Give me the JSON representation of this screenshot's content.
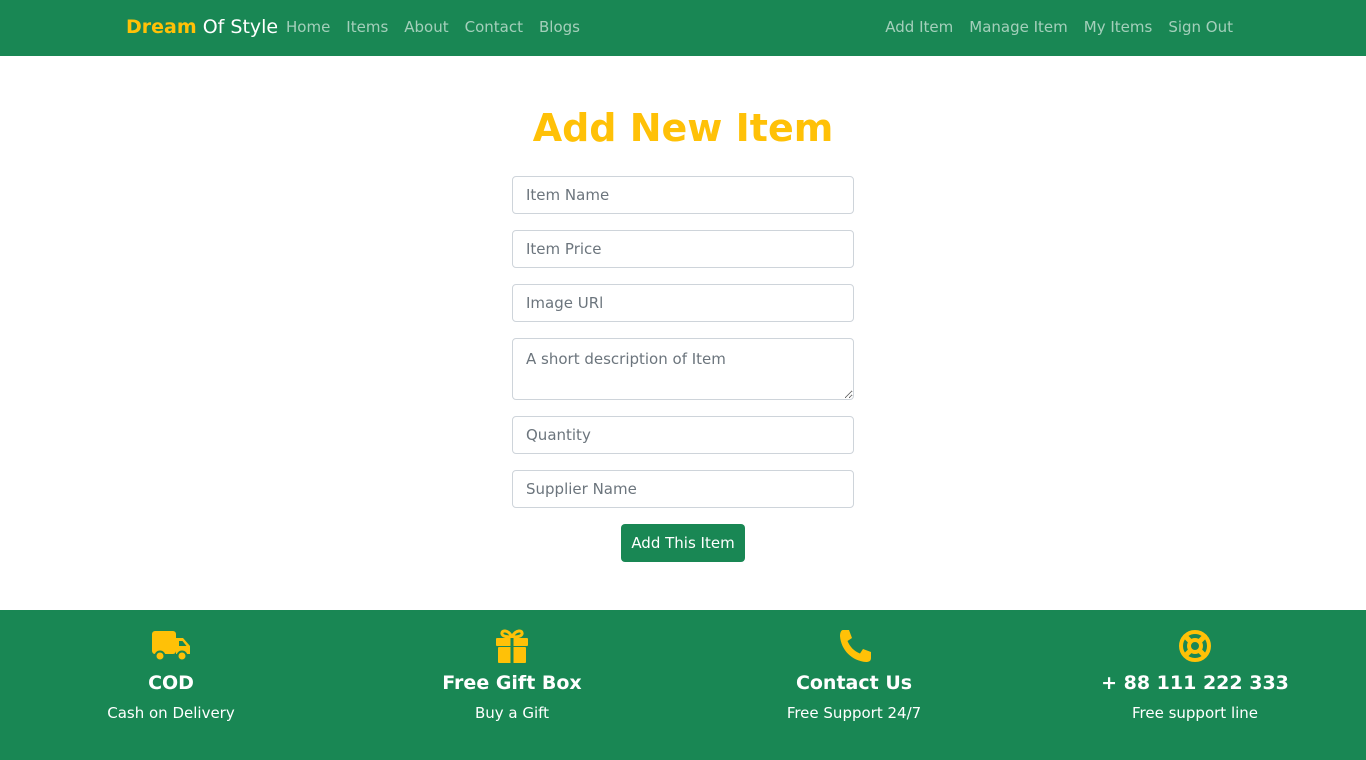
{
  "navbar": {
    "brand_first": "Dream",
    "brand_rest": "Of Style",
    "left_links": [
      "Home",
      "Items",
      "About",
      "Contact",
      "Blogs"
    ],
    "right_links": [
      "Add Item",
      "Manage Item",
      "My Items",
      "Sign Out"
    ]
  },
  "form": {
    "title": "Add New Item",
    "fields": {
      "item_name": {
        "placeholder": "Item Name",
        "value": ""
      },
      "item_price": {
        "placeholder": "Item Price",
        "value": ""
      },
      "image_url": {
        "placeholder": "Image URl",
        "value": ""
      },
      "description": {
        "placeholder": "A short description of Item",
        "value": ""
      },
      "quantity": {
        "placeholder": "Quantity",
        "value": ""
      },
      "supplier_name": {
        "placeholder": "Supplier Name",
        "value": ""
      }
    },
    "submit_label": "Add This Item"
  },
  "footer": {
    "features": [
      {
        "icon": "truck-icon",
        "title": "COD",
        "subtitle": "Cash on Delivery"
      },
      {
        "icon": "gift-icon",
        "title": "Free Gift Box",
        "subtitle": "Buy a Gift"
      },
      {
        "icon": "phone-icon",
        "title": "Contact Us",
        "subtitle": "Free Support 24/7"
      },
      {
        "icon": "life-ring-icon",
        "title": "+ 88 111 222 333",
        "subtitle": "Free support line"
      }
    ]
  },
  "colors": {
    "primary_green": "#198754",
    "accent_yellow": "#ffc107",
    "nav_link": "rgba(255,255,255,0.6)"
  }
}
